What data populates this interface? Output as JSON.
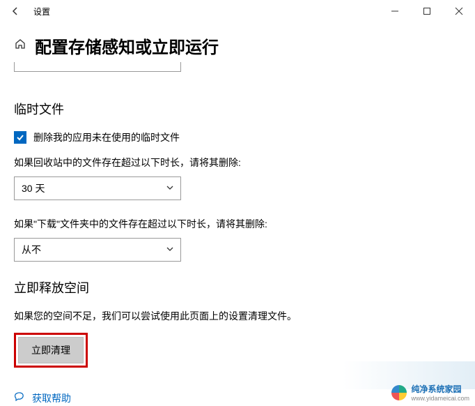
{
  "window": {
    "title": "设置"
  },
  "page": {
    "title": "配置存储感知或立即运行"
  },
  "temp_files": {
    "heading": "临时文件",
    "checkbox_label": "删除我的应用未在使用的临时文件",
    "recycle_bin_desc": "如果回收站中的文件存在超过以下时长，请将其删除:",
    "recycle_bin_value": "30 天",
    "downloads_desc": "如果\"下载\"文件夹中的文件存在超过以下时长，请将其删除:",
    "downloads_value": "从不"
  },
  "free_space": {
    "heading": "立即释放空间",
    "desc": "如果您的空间不足，我们可以尝试使用此页面上的设置清理文件。",
    "button": "立即清理"
  },
  "help": {
    "link": "获取帮助"
  },
  "watermark": {
    "name": "纯净系统家园",
    "url": "www.yidameicai.com"
  }
}
